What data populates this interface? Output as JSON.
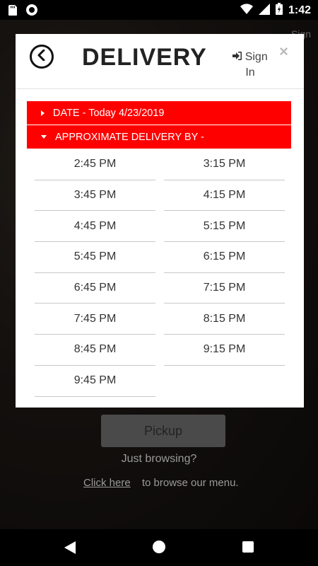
{
  "status_bar": {
    "time": "1:42"
  },
  "background": {
    "sign_in_label": "Sign",
    "pickup_label": "Pickup",
    "just_browsing": "Just browsing?",
    "click_here": "Click here",
    "browse_menu": "to browse our menu."
  },
  "modal": {
    "title": "DELIVERY",
    "sign_in": "Sign In",
    "close": "×",
    "date_section": "DATE - Today 4/23/2019",
    "delivery_section": "APPROXIMATE DELIVERY BY -",
    "times": [
      "2:45 PM",
      "3:15 PM",
      "3:45 PM",
      "4:15 PM",
      "4:45 PM",
      "5:15 PM",
      "5:45 PM",
      "6:15 PM",
      "6:45 PM",
      "7:15 PM",
      "7:45 PM",
      "8:15 PM",
      "8:45 PM",
      "9:15 PM",
      "9:45 PM"
    ]
  },
  "colors": {
    "accent": "#ff0000"
  }
}
